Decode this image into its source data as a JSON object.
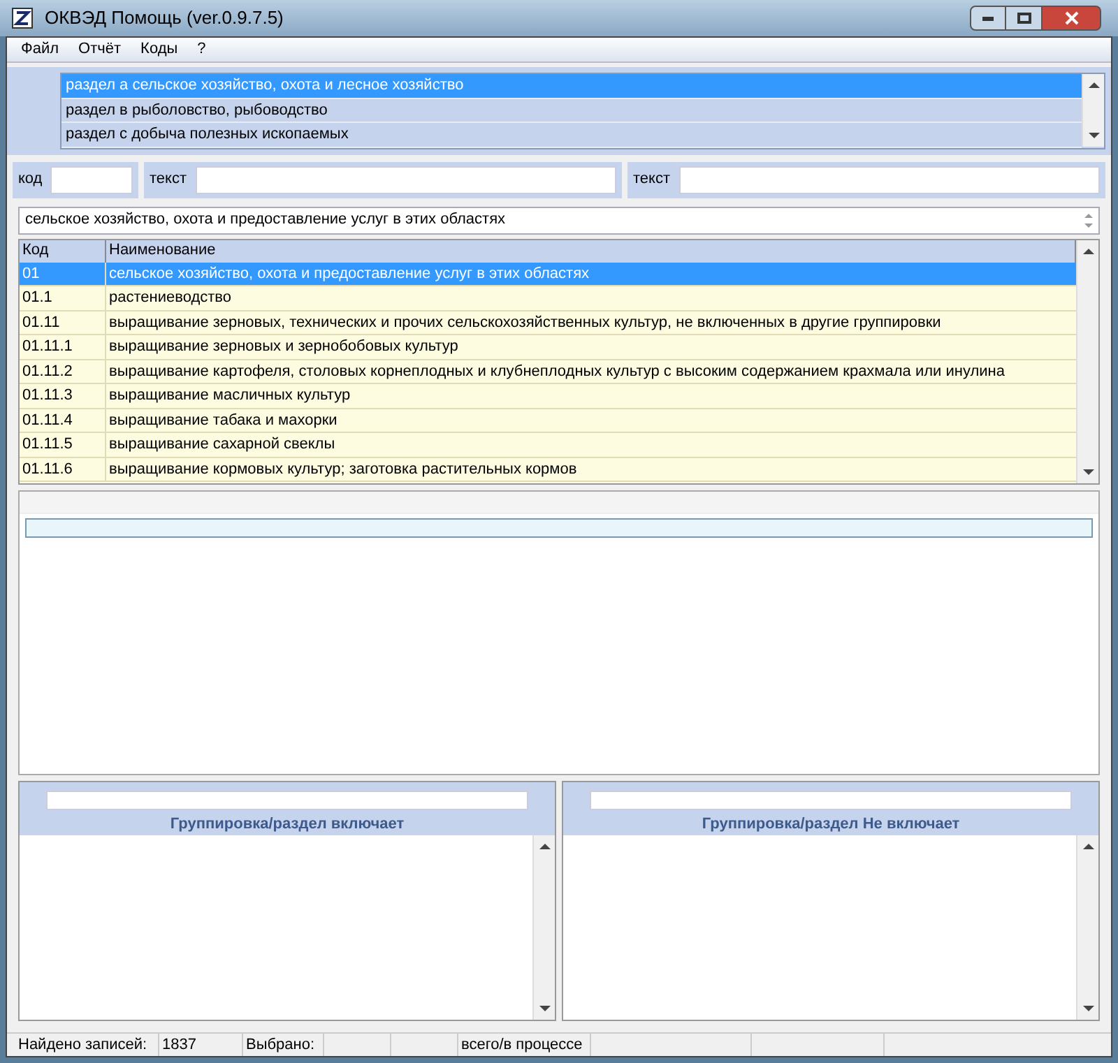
{
  "window": {
    "title": "ОКВЭД Помощь (ver.0.9.7.5)"
  },
  "menu": [
    "Файл",
    "Отчёт",
    "Коды",
    "?"
  ],
  "sections": [
    {
      "label": "раздел а сельское хозяйство, охота и лесное хозяйство",
      "selected": true
    },
    {
      "label": "раздел в рыболовство, рыбоводство",
      "selected": false
    },
    {
      "label": "раздел с добыча полезных ископаемых",
      "selected": false
    }
  ],
  "search": [
    {
      "label": "код"
    },
    {
      "label": "текст"
    },
    {
      "label": "текст"
    }
  ],
  "description": {
    "value": "сельское хозяйство, охота и предоставление услуг в этих областях"
  },
  "table": {
    "columns": [
      "Код",
      "Наименование"
    ],
    "rows": [
      {
        "code": "01",
        "name": "сельское хозяйство, охота и предоставление услуг в этих областях",
        "selected": true
      },
      {
        "code": "01.1",
        "name": "растениеводство",
        "selected": false
      },
      {
        "code": "01.11",
        "name": "выращивание зерновых, технических и прочих сельскохозяйственных культур, не включенных в другие группировки",
        "selected": false
      },
      {
        "code": "01.11.1",
        "name": "выращивание зерновых и зернобобовых культур",
        "selected": false
      },
      {
        "code": "01.11.2",
        "name": "выращивание картофеля, столовых корнеплодных и клубнеплодных культур с высоким содержанием крахмала или инулина",
        "selected": false
      },
      {
        "code": "01.11.3",
        "name": "выращивание масличных культур",
        "selected": false
      },
      {
        "code": "01.11.4",
        "name": "выращивание табака и махорки",
        "selected": false
      },
      {
        "code": "01.11.5",
        "name": "выращивание сахарной свеклы",
        "selected": false
      },
      {
        "code": "01.11.6",
        "name": "выращивание кормовых культур; заготовка растительных кормов",
        "selected": false
      }
    ]
  },
  "panels": [
    {
      "title": "Группировка/раздел включает"
    },
    {
      "title": "Группировка/раздел Не включает"
    }
  ],
  "progress": {
    "level": 0
  },
  "status_bar": [
    "Найдено записей:",
    "1837",
    "Выбрано:",
    "всего/в процессе"
  ]
}
